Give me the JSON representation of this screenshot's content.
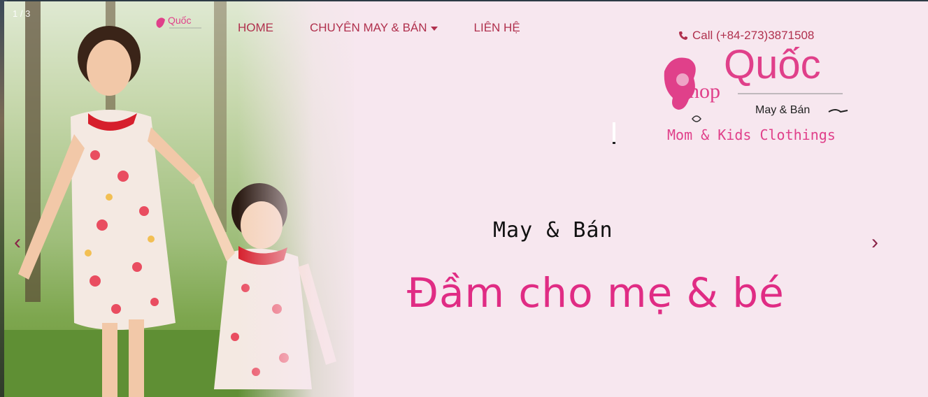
{
  "slider": {
    "counter": "1 / 3",
    "prev_symbol": "‹",
    "next_symbol": "›"
  },
  "nav": {
    "items": [
      "HOME",
      "CHUYÊN MAY & BÁN",
      "LIÊN HỆ"
    ]
  },
  "contact": {
    "call": "Call (+84-273)3871508"
  },
  "logo": {
    "brand": "Quốc",
    "shop": "hop",
    "tagline1": "May & Bán",
    "tagline2": "Mom & Kids Clothings"
  },
  "hero": {
    "subtitle": "May & Bán",
    "headline": "Đầm cho mẹ & bé"
  },
  "colors": {
    "accent": "#e02c84",
    "nav_text": "#b0304d",
    "background": "#f7e7ef"
  }
}
